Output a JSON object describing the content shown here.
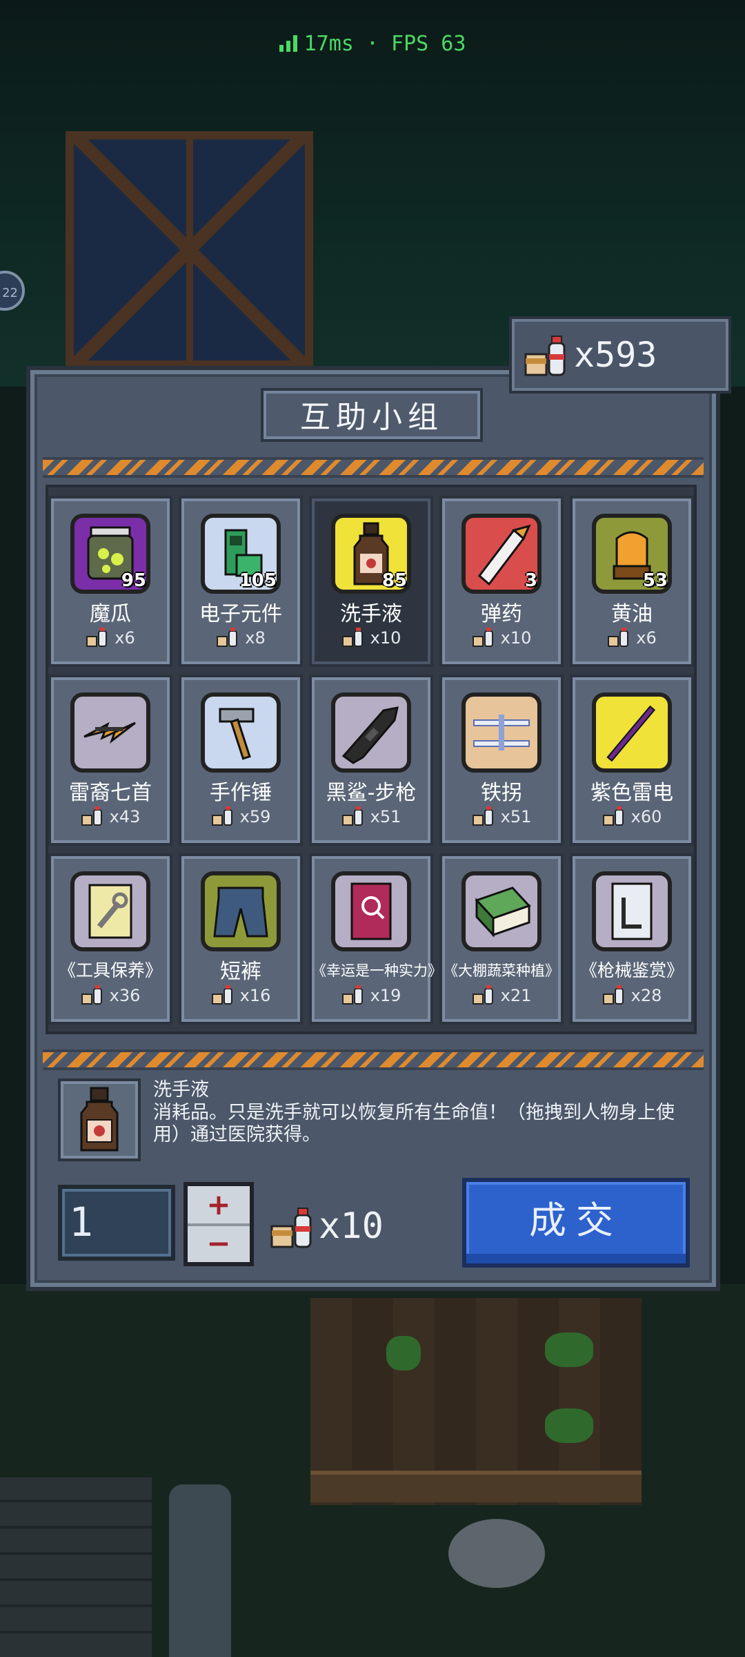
{
  "status": {
    "ping": "17ms · FPS 63"
  },
  "side_badge": "22",
  "currency": {
    "count": "x593"
  },
  "shop": {
    "title": "互助小组",
    "items": [
      {
        "name": "魔瓜",
        "stock": "95",
        "price": "x6",
        "icon": "magic-melon-jar-icon",
        "color": "#7a2fa8"
      },
      {
        "name": "电子元件",
        "stock": "105",
        "price": "x8",
        "icon": "circuit-board-icon",
        "color": "#c9d8ee"
      },
      {
        "name": "洗手液",
        "stock": "85",
        "price": "x10",
        "icon": "hand-sanitizer-bottle-icon",
        "color": "#f1e23a"
      },
      {
        "name": "弹药",
        "stock": "3",
        "price": "x10",
        "icon": "ammo-cartridge-icon",
        "color": "#d94d4d"
      },
      {
        "name": "黄油",
        "stock": "53",
        "price": "x6",
        "icon": "butter-icon",
        "color": "#8e9a3a"
      },
      {
        "name": "雷裔七首",
        "stock": "",
        "price": "x43",
        "icon": "lightning-dagger-icon",
        "color": "#b6aec4"
      },
      {
        "name": "手作锤",
        "stock": "",
        "price": "x59",
        "icon": "hammer-icon",
        "color": "#c9d8ee"
      },
      {
        "name": "黑鲨-步枪",
        "stock": "",
        "price": "x51",
        "icon": "rifle-icon",
        "color": "#b6aec4"
      },
      {
        "name": "铁拐",
        "stock": "",
        "price": "x51",
        "icon": "iron-crutch-icon",
        "color": "#e8c49a"
      },
      {
        "name": "紫色雷电",
        "stock": "",
        "price": "x60",
        "icon": "purple-staff-icon",
        "color": "#f1e23a"
      },
      {
        "name": "《工具保养》",
        "stock": "",
        "price": "x36",
        "icon": "tool-book-icon",
        "color": "#b6aec4"
      },
      {
        "name": "短裤",
        "stock": "",
        "price": "x16",
        "icon": "shorts-icon",
        "color": "#8e9a3a"
      },
      {
        "name": "《幸运是一种实力》",
        "stock": "",
        "price": "x19",
        "icon": "luck-book-icon",
        "color": "#b6aec4"
      },
      {
        "name": "《大棚蔬菜种植》",
        "stock": "",
        "price": "x21",
        "icon": "greenhouse-book-icon",
        "color": "#b6aec4"
      },
      {
        "name": "《枪械鉴赏》",
        "stock": "",
        "price": "x28",
        "icon": "gun-book-icon",
        "color": "#b6aec4"
      }
    ]
  },
  "detail": {
    "name": "洗手液",
    "description": "消耗品。只是洗手就可以恢复所有生命值！（拖拽到人物身上使用）通过医院获得。"
  },
  "purchase": {
    "quantity": "1",
    "plus": "+",
    "minus": "−",
    "total": "x10",
    "deal_label": "成交"
  },
  "colors": {
    "accent_blue": "#2d62cc",
    "hazard_orange": "#e08a2e",
    "ping_green": "#4cd964"
  }
}
